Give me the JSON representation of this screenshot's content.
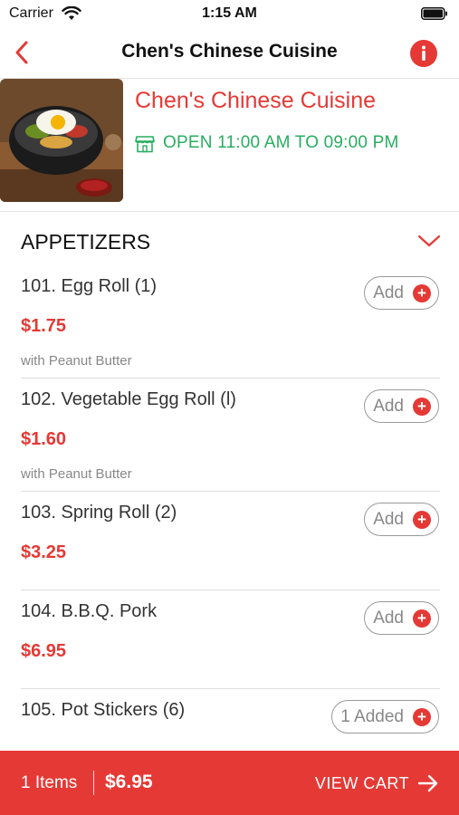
{
  "status_bar": {
    "carrier": "Carrier",
    "time": "1:15 AM",
    "wifi_icon": "wifi-icon",
    "battery_icon": "battery-icon"
  },
  "nav": {
    "title": "Chen's Chinese Cuisine",
    "back_icon": "chevron-left-icon",
    "info_icon": "info-icon"
  },
  "restaurant": {
    "name": "Chen's Chinese Cuisine",
    "hours": "OPEN 11:00 AM TO 09:00 PM",
    "store_icon": "store-icon"
  },
  "category": {
    "title": "APPETIZERS",
    "expand_icon": "chevron-down-icon"
  },
  "items": [
    {
      "name": "101. Egg Roll (1)",
      "price": "$1.75",
      "description": "with Peanut Butter",
      "button": "Add"
    },
    {
      "name": "102. Vegetable Egg Roll (l)",
      "price": "$1.60",
      "description": "with Peanut Butter",
      "button": "Add"
    },
    {
      "name": "103. Spring Roll (2)",
      "price": "$3.25",
      "description": "",
      "button": "Add"
    },
    {
      "name": "104. B.B.Q. Pork",
      "price": "$6.95",
      "description": "",
      "button": "Add"
    },
    {
      "name": "105. Pot Stickers (6)",
      "price": "",
      "description": "",
      "button": "1 Added"
    }
  ],
  "plus_symbol": "+",
  "cart": {
    "count": "1 Items",
    "total": "$6.95",
    "view_label": "VIEW CART",
    "arrow_icon": "arrow-right-icon"
  },
  "colors": {
    "accent": "#e53935",
    "open_status": "#27ae60"
  }
}
